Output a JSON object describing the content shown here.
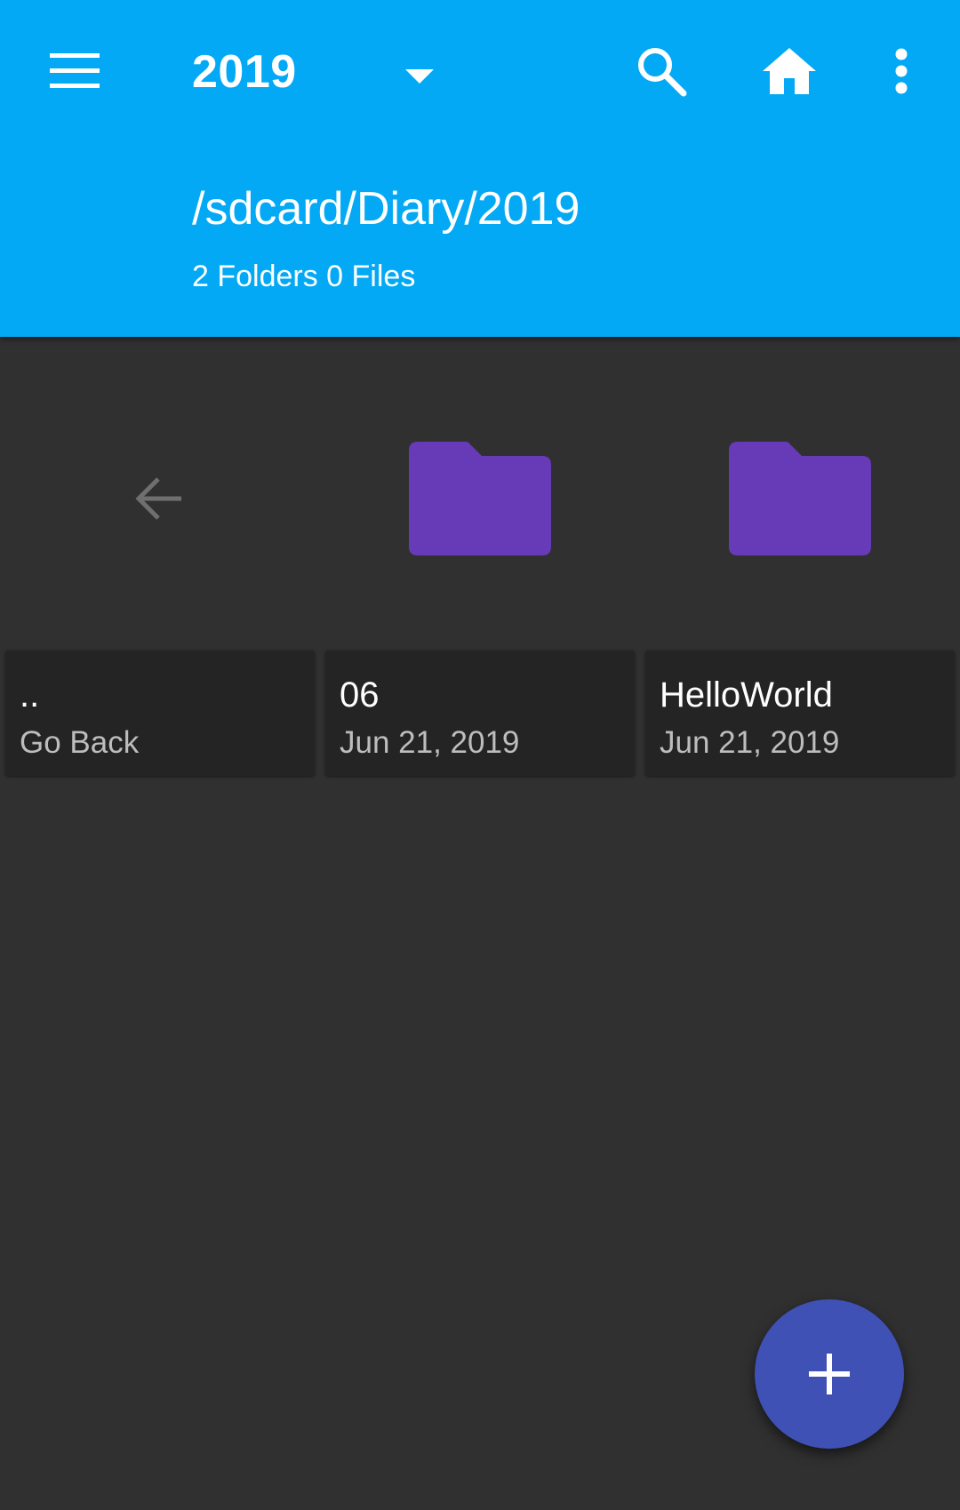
{
  "toolbar": {
    "title": "2019",
    "path": "/sdcard/Diary/2019",
    "summary": "2 Folders 0 Files",
    "icons": {
      "menu": "menu-icon",
      "dropdown": "dropdown-arrow-icon",
      "search": "search-icon",
      "home": "home-icon",
      "more": "more-vertical-icon"
    }
  },
  "items": [
    {
      "name": "..",
      "subtitle": "Go Back",
      "type": "parent",
      "icon": "arrow-back-icon"
    },
    {
      "name": "06",
      "subtitle": "Jun 21, 2019",
      "type": "folder",
      "icon": "folder-icon"
    },
    {
      "name": "HelloWorld",
      "subtitle": "Jun 21, 2019",
      "type": "folder",
      "icon": "folder-icon"
    }
  ],
  "fab": {
    "icon": "plus-icon"
  },
  "colors": {
    "appbar": "#03A9F4",
    "background": "#303030",
    "card": "#242424",
    "folder": "#673AB7",
    "fab": "#3F51B5"
  }
}
